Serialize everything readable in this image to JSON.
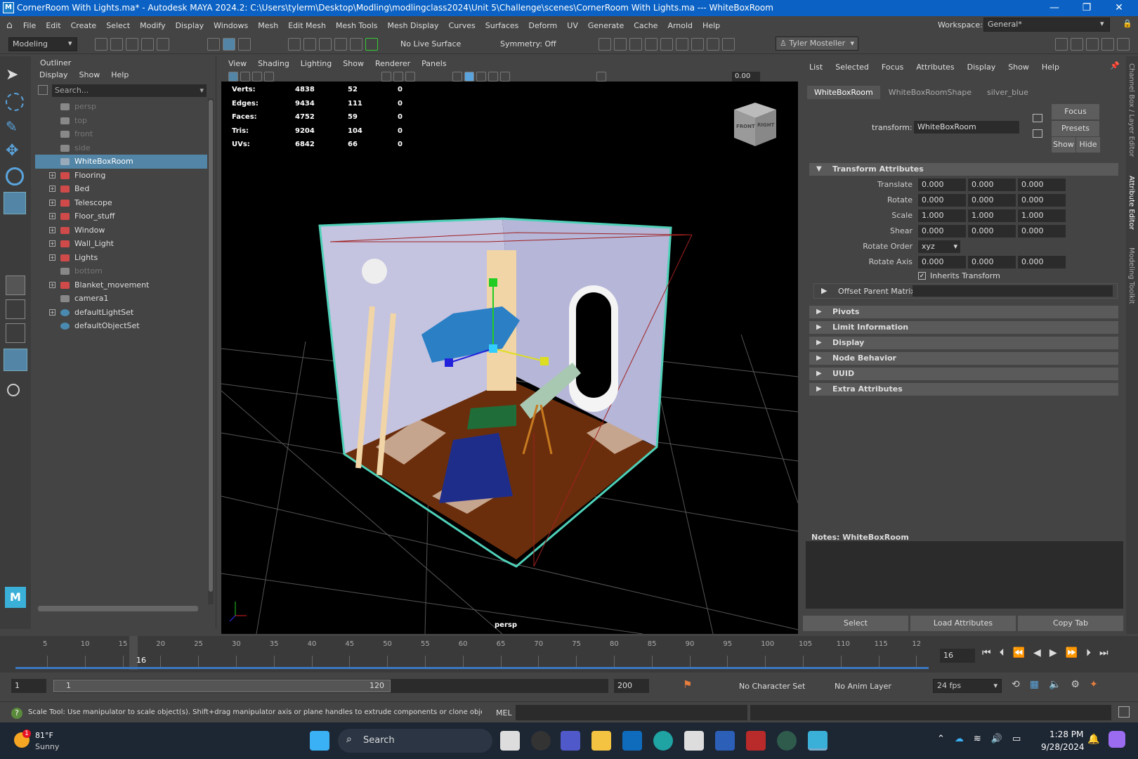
{
  "title": {
    "text": "CornerRoom With Lights.ma* - Autodesk MAYA 2024.2: C:\\Users\\tylerm\\Desktop\\Modling\\modlingclass2024\\Unit 5\\Challenge\\scenes\\CornerRoom With Lights.ma   ---   WhiteBoxRoom",
    "minimize": "—",
    "restore": "❐",
    "close": "✕"
  },
  "menu": [
    "File",
    "Edit",
    "Create",
    "Select",
    "Modify",
    "Display",
    "Windows",
    "Mesh",
    "Edit Mesh",
    "Mesh Tools",
    "Mesh Display",
    "Curves",
    "Surfaces",
    "Deform",
    "UV",
    "Generate",
    "Cache",
    "Arnold",
    "Help"
  ],
  "workspace": {
    "label": "Workspace:",
    "value": "General*"
  },
  "shelf": {
    "mode": "Modeling",
    "live_surface": "No Live Surface",
    "symmetry": "Symmetry: Off",
    "user": "Tyler Mosteller"
  },
  "outliner": {
    "title": "Outliner",
    "menu": [
      "Display",
      "Show",
      "Help"
    ],
    "search_placeholder": "Search...",
    "items": [
      {
        "name": "persp",
        "dim": true,
        "expand": false,
        "icon": "camera"
      },
      {
        "name": "top",
        "dim": true,
        "expand": false,
        "icon": "camera"
      },
      {
        "name": "front",
        "dim": true,
        "expand": false,
        "icon": "camera"
      },
      {
        "name": "side",
        "dim": true,
        "expand": false,
        "icon": "camera"
      },
      {
        "name": "WhiteBoxRoom",
        "dim": false,
        "expand": false,
        "icon": "mesh",
        "selected": true
      },
      {
        "name": "Flooring",
        "dim": false,
        "expand": true,
        "icon": "group"
      },
      {
        "name": "Bed",
        "dim": false,
        "expand": true,
        "icon": "group"
      },
      {
        "name": "Telescope",
        "dim": false,
        "expand": true,
        "icon": "group"
      },
      {
        "name": "Floor_stuff",
        "dim": false,
        "expand": true,
        "icon": "group"
      },
      {
        "name": "Window",
        "dim": false,
        "expand": true,
        "icon": "group"
      },
      {
        "name": "Wall_Light",
        "dim": false,
        "expand": true,
        "icon": "group"
      },
      {
        "name": "Lights",
        "dim": false,
        "expand": true,
        "icon": "group"
      },
      {
        "name": "bottom",
        "dim": true,
        "expand": false,
        "icon": "camera"
      },
      {
        "name": "Blanket_movement",
        "dim": false,
        "expand": true,
        "icon": "group"
      },
      {
        "name": "camera1",
        "dim": false,
        "expand": false,
        "icon": "camera"
      },
      {
        "name": "defaultLightSet",
        "dim": false,
        "expand": true,
        "icon": "set"
      },
      {
        "name": "defaultObjectSet",
        "dim": false,
        "expand": false,
        "icon": "set"
      }
    ]
  },
  "viewport": {
    "menu": [
      "View",
      "Shading",
      "Lighting",
      "Show",
      "Renderer",
      "Panels"
    ],
    "exposure": "0.00",
    "camera_label": "persp",
    "viewcube": {
      "front": "FRONT",
      "right": "RIGHT"
    },
    "stats": [
      {
        "label": "Verts:",
        "a": "4838",
        "b": "52",
        "c": "0"
      },
      {
        "label": "Edges:",
        "a": "9434",
        "b": "111",
        "c": "0"
      },
      {
        "label": "Faces:",
        "a": "4752",
        "b": "59",
        "c": "0"
      },
      {
        "label": "Tris:",
        "a": "9204",
        "b": "104",
        "c": "0"
      },
      {
        "label": "UVs:",
        "a": "6842",
        "b": "66",
        "c": "0"
      }
    ]
  },
  "attr": {
    "menu": [
      "List",
      "Selected",
      "Focus",
      "Attributes",
      "Display",
      "Show",
      "Help"
    ],
    "tabs": [
      "WhiteBoxRoom",
      "WhiteBoxRoomShape",
      "silver_blue"
    ],
    "transform_label": "transform:",
    "transform_value": "WhiteBoxRoom",
    "buttons": {
      "focus": "Focus",
      "presets": "Presets",
      "show": "Show",
      "hide": "Hide"
    },
    "section": "Transform Attributes",
    "rows": [
      {
        "label": "Translate",
        "v": [
          "0.000",
          "0.000",
          "0.000"
        ]
      },
      {
        "label": "Rotate",
        "v": [
          "0.000",
          "0.000",
          "0.000"
        ]
      },
      {
        "label": "Scale",
        "v": [
          "1.000",
          "1.000",
          "1.000"
        ]
      },
      {
        "label": "Shear",
        "v": [
          "0.000",
          "0.000",
          "0.000"
        ]
      }
    ],
    "rotate_order_label": "Rotate Order",
    "rotate_order": "xyz",
    "rotate_axis_label": "Rotate Axis",
    "rotate_axis": [
      "0.000",
      "0.000",
      "0.000"
    ],
    "inherits": "Inherits Transform",
    "offset": "Offset Parent Matrix",
    "collapsed": [
      "Pivots",
      "Limit Information",
      "Display",
      "Node Behavior",
      "UUID",
      "Extra Attributes"
    ],
    "notes": "Notes:  WhiteBoxRoom",
    "footer": [
      "Select",
      "Load Attributes",
      "Copy Tab"
    ],
    "side_tabs": [
      "Channel Box / Layer Editor",
      "Attribute Editor",
      "Modeling Toolkit"
    ]
  },
  "timeline": {
    "ticks": [
      "5",
      "10",
      "15",
      "20",
      "25",
      "30",
      "35",
      "40",
      "45",
      "50",
      "55",
      "60",
      "65",
      "70",
      "75",
      "80",
      "85",
      "90",
      "95",
      "100",
      "105",
      "110",
      "115",
      "12"
    ],
    "current": "16",
    "current_field": "16"
  },
  "range": {
    "start": "1",
    "inner_start": "1",
    "inner_end": "120",
    "end": "200",
    "char_set": "No Character Set",
    "anim_layer": "No Anim Layer",
    "fps": "24 fps"
  },
  "help": {
    "text": "Scale Tool: Use manipulator to scale object(s). Shift+drag manipulator axis or plane handles to extrude components or clone objects. Ctrl+Shift+LME",
    "lang": "MEL"
  },
  "taskbar": {
    "temp": "81°F",
    "weather": "Sunny",
    "badge": "1",
    "search": "Search",
    "time": "1:28 PM",
    "date": "9/28/2024"
  }
}
